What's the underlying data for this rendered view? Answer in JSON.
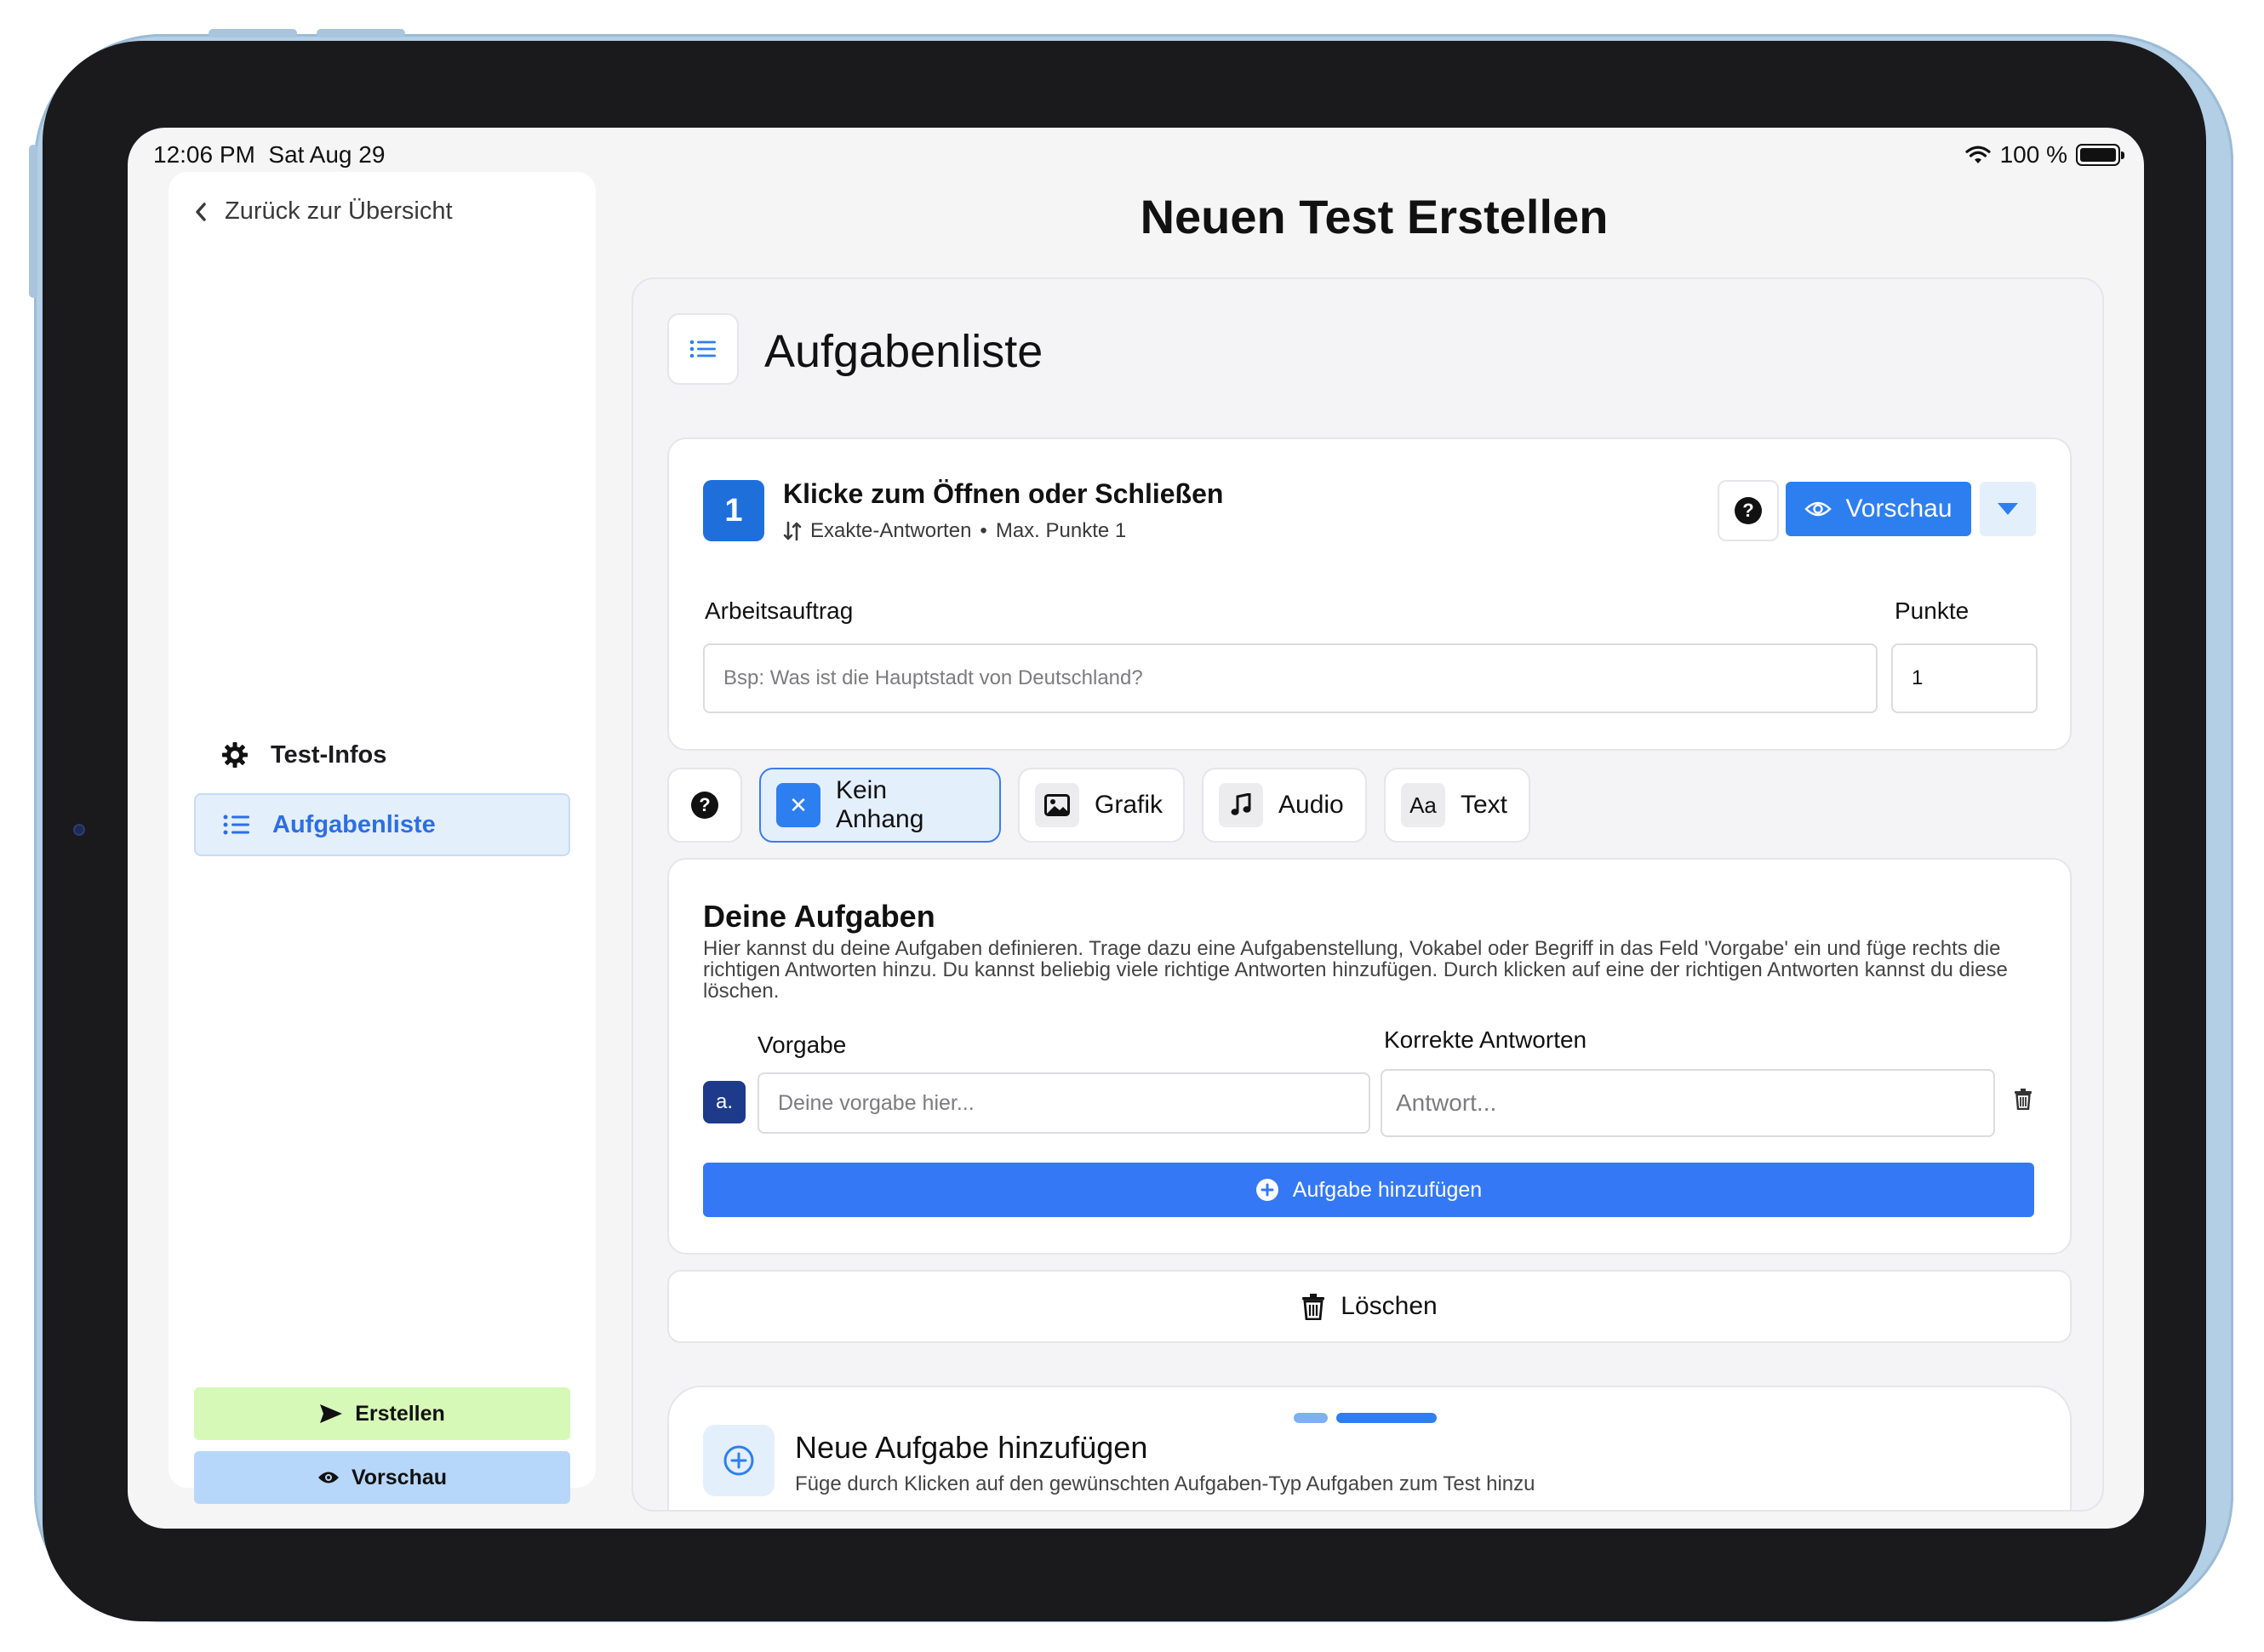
{
  "status_bar": {
    "time": "12:06 PM",
    "date": "Sat Aug 29",
    "battery": "100 %"
  },
  "sidebar": {
    "back_label": "Zurück zur Übersicht",
    "items": [
      {
        "label": "Test-Infos",
        "icon": "gear-icon",
        "active": false
      },
      {
        "label": "Aufgabenliste",
        "icon": "list-icon",
        "active": true
      }
    ],
    "create_label": "Erstellen",
    "preview_label": "Vorschau"
  },
  "page": {
    "title": "Neuen Test Erstellen",
    "section_title": "Aufgabenliste"
  },
  "task": {
    "number": "1",
    "title": "Klicke zum Öffnen oder Schließen",
    "type": "Exakte-Antworten",
    "separator": "•",
    "max_points": "Max. Punkte 1",
    "preview_label": "Vorschau",
    "instruction_label": "Arbeitsauftrag",
    "instruction_placeholder": "Bsp: Was ist die Hauptstadt von Deutschland?",
    "points_label": "Punkte",
    "points_value": "1"
  },
  "attachments": {
    "options": [
      {
        "label": "Kein Anhang",
        "icon": "close-icon",
        "selected": true
      },
      {
        "label": "Grafik",
        "icon": "image-icon",
        "selected": false
      },
      {
        "label": "Audio",
        "icon": "music-note-icon",
        "selected": false
      },
      {
        "label": "Text",
        "icon": "text-format-icon",
        "selected": false
      }
    ]
  },
  "subtasks": {
    "title": "Deine Aufgaben",
    "description": "Hier kannst du deine Aufgaben definieren. Trage dazu eine Aufgabenstellung, Vokabel oder Begriff in das Feld 'Vorgabe' ein und füge rechts die richtigen Antworten hinzu. Du kannst beliebig viele richtige Antworten hinzufügen. Durch klicken auf eine der richtigen Antworten kannst du diese löschen.",
    "col_vorgabe": "Vorgabe",
    "col_antworten": "Korrekte Antworten",
    "rows": [
      {
        "letter": "a.",
        "vorgabe_placeholder": "Deine vorgabe hier...",
        "answer_placeholder": "Antwort..."
      }
    ],
    "add_label": "Aufgabe hinzufügen"
  },
  "delete_label": "Löschen",
  "new_task": {
    "title": "Neue Aufgabe hinzufügen",
    "description": "Füge durch Klicken auf den gewünschten Aufgaben-Typ Aufgaben zum Test hinzu"
  },
  "colors": {
    "accent": "#2d7ff0",
    "badge_dark": "#1e3a8a",
    "create_green": "#d7f9b8",
    "preview_blue": "#b7d7fa"
  }
}
